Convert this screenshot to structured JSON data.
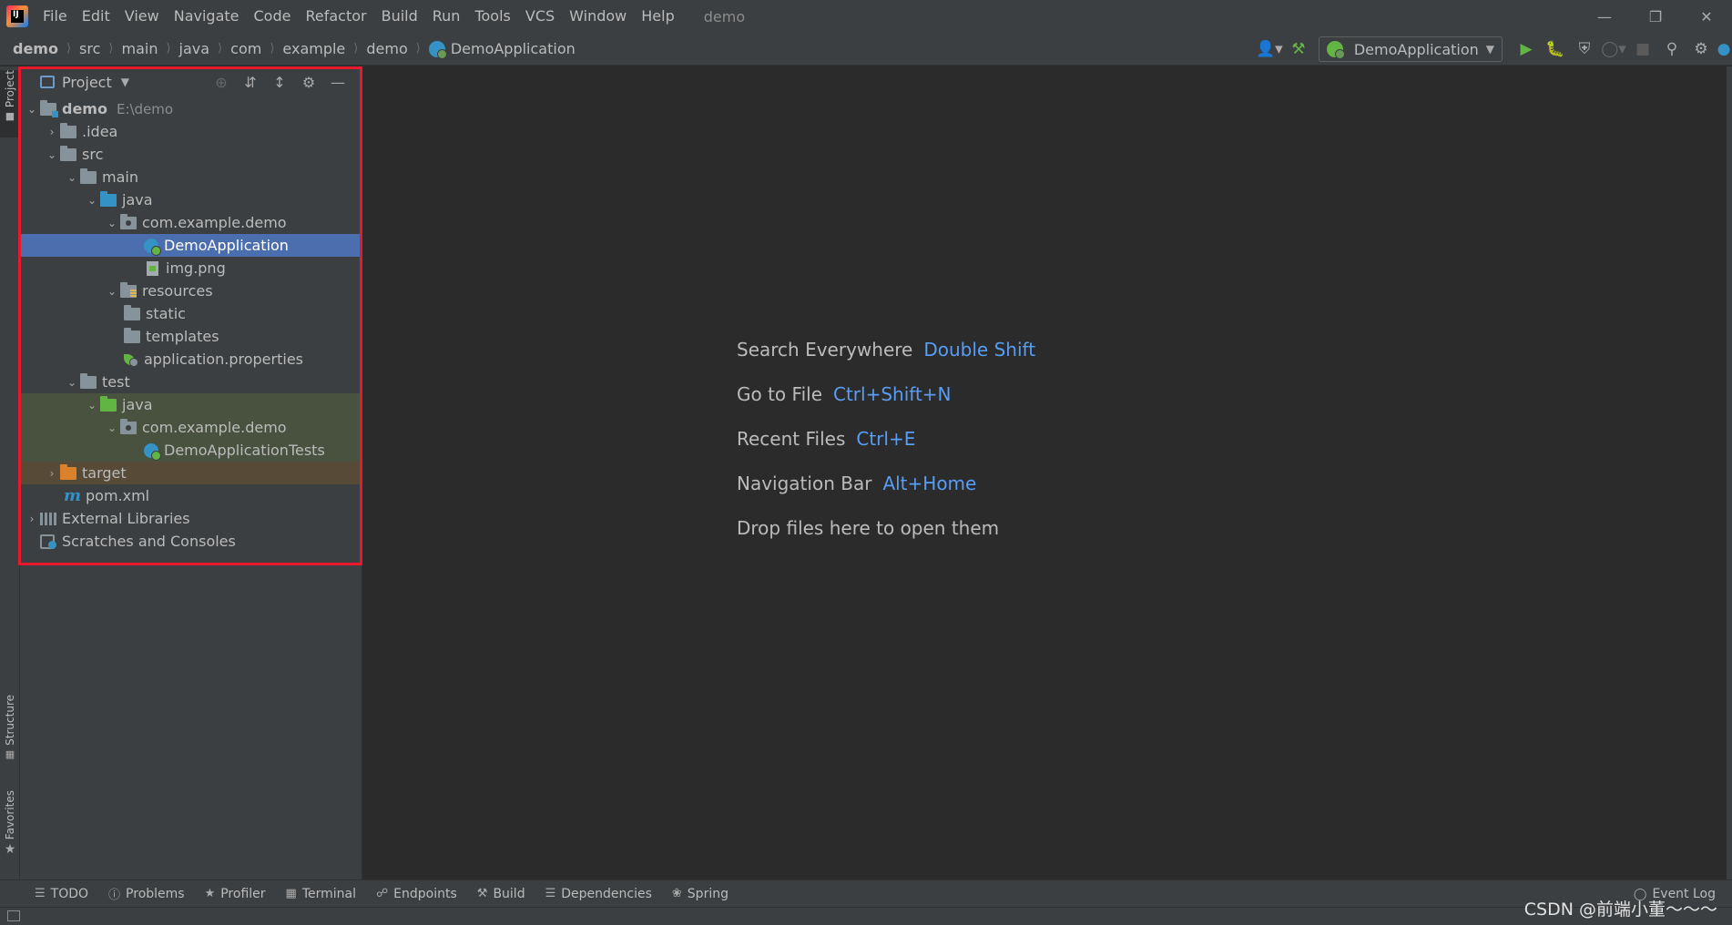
{
  "menubar": {
    "items": [
      "File",
      "Edit",
      "View",
      "Navigate",
      "Code",
      "Refactor",
      "Build",
      "Run",
      "Tools",
      "VCS",
      "Window",
      "Help"
    ],
    "window_title": "demo"
  },
  "breadcrumbs": [
    "demo",
    "src",
    "main",
    "java",
    "com",
    "example",
    "demo",
    "DemoApplication"
  ],
  "toolbar": {
    "run_config": "DemoApplication"
  },
  "left_stripe": {
    "project": "Project",
    "structure": "Structure",
    "favorites": "Favorites"
  },
  "project_panel": {
    "title": "Project",
    "tree": {
      "root": {
        "label": "demo",
        "path": "E:\\demo"
      },
      "idea": ".idea",
      "src": "src",
      "main": "main",
      "java": "java",
      "pkg": "com.example.demo",
      "demo_app": "DemoApplication",
      "img": "img.png",
      "resources": "resources",
      "static": "static",
      "templates": "templates",
      "app_props": "application.properties",
      "test": "test",
      "test_java": "java",
      "test_pkg": "com.example.demo",
      "test_class": "DemoApplicationTests",
      "target": "target",
      "pom": "pom.xml",
      "ext_libs": "External Libraries",
      "scratches": "Scratches and Consoles"
    }
  },
  "editor": {
    "hints": [
      {
        "label": "Search Everywhere",
        "key": "Double Shift"
      },
      {
        "label": "Go to File",
        "key": "Ctrl+Shift+N"
      },
      {
        "label": "Recent Files",
        "key": "Ctrl+E"
      },
      {
        "label": "Navigation Bar",
        "key": "Alt+Home"
      },
      {
        "label": "Drop files here to open them",
        "key": ""
      }
    ]
  },
  "bottom_tabs": [
    "TODO",
    "Problems",
    "Profiler",
    "Terminal",
    "Endpoints",
    "Build",
    "Dependencies",
    "Spring"
  ],
  "event_log": "Event Log",
  "watermark": "CSDN @前端小董～～～",
  "colors": {
    "accent": "#4b6eaf",
    "highlight_border": "#e8192c",
    "shortcut": "#589df6"
  }
}
